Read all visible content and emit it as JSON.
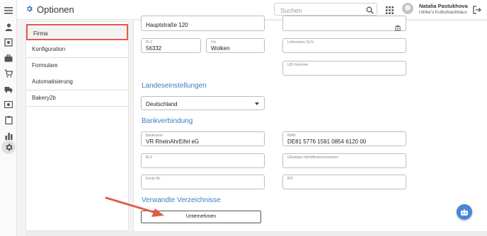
{
  "app": {
    "title": "Optionen",
    "accent": "#3d7bc4",
    "highlight": "#e25b4a"
  },
  "search": {
    "placeholder": "Suchen"
  },
  "user": {
    "name": "Natalia Pastukhova",
    "org": "Ulrike's Kulturbackhaus"
  },
  "rail_icons": [
    "menu-icon",
    "person-icon",
    "target-icon",
    "briefcase-icon",
    "cart-icon",
    "truck-icon",
    "money-icon",
    "clipboard-icon",
    "bar-chart-icon",
    "gear-icon"
  ],
  "menu": {
    "items": [
      {
        "label": "Firma",
        "active": true
      },
      {
        "label": "Konfiguration"
      },
      {
        "label": "Formulare"
      },
      {
        "label": "Automatisierung"
      },
      {
        "label": "Bakery2b"
      }
    ]
  },
  "form": {
    "street_value": "Hauptstraße 120",
    "gln_label": "Lieferanten GLN",
    "plz": {
      "label": "PLZ",
      "value": "56332"
    },
    "ort": {
      "label": "Ort",
      "value": "Wolken"
    },
    "uid_label": "UID-Nummer",
    "landes_section": "Landeseinstellungen",
    "country_value": "Deutschland",
    "bank_section": "Bankverbindung",
    "bankname": {
      "label": "Bankname",
      "value": "VR RheinAhrEifel eG"
    },
    "iban": {
      "label": "IBAN",
      "value": "DE81 5776 1591 0854 6120 00"
    },
    "blz_label": "BLZ",
    "glaeubiger_label": "Gläubiger-Identifikationsnummer",
    "konto_label": "Konto-Nr.",
    "bic_label": "BIC",
    "related_section": "Verwandte Verzeichnisse",
    "unternehmen_button": "Unternehmen"
  }
}
